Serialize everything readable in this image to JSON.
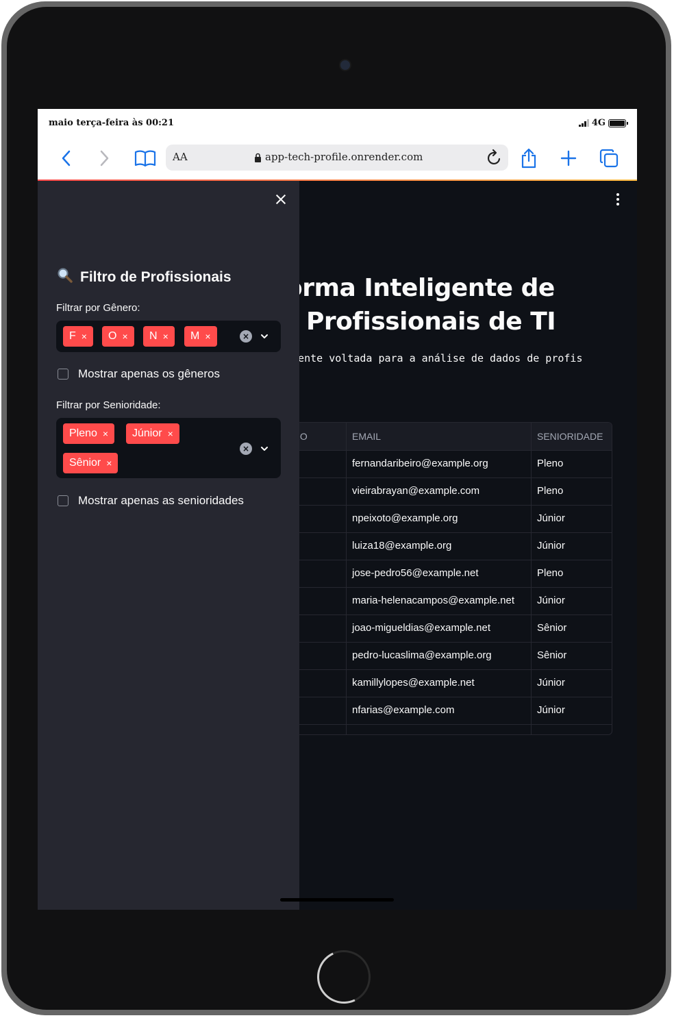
{
  "status_bar": {
    "datetime": "maio terça-feira às 00:21",
    "network": "4G"
  },
  "browser": {
    "reader_label": "AA",
    "url": "app-tech-profile.onrender.com"
  },
  "main": {
    "title_line1": "orma Inteligente de",
    "title_line2": "e Profissionais de TI",
    "subtitle": "igente voltada para a análise de dados de profis",
    "table": {
      "columns": [
        "ENERO",
        "EMAIL",
        "SENIORIDADE"
      ],
      "rows": [
        {
          "email": "fernandaribeiro@example.org",
          "senioridade": "Pleno"
        },
        {
          "email": "vieirabrayan@example.com",
          "senioridade": "Pleno"
        },
        {
          "email": "npeixoto@example.org",
          "senioridade": "Júnior"
        },
        {
          "email": "luiza18@example.org",
          "senioridade": "Júnior"
        },
        {
          "email": "jose-pedro56@example.net",
          "senioridade": "Pleno"
        },
        {
          "email": "maria-helenacampos@example.net",
          "senioridade": "Júnior"
        },
        {
          "email": "joao-migueldias@example.net",
          "senioridade": "Sênior"
        },
        {
          "email": "pedro-lucaslima@example.org",
          "senioridade": "Sênior"
        },
        {
          "email": "kamillylopes@example.net",
          "senioridade": "Júnior"
        },
        {
          "email": "nfarias@example.com",
          "senioridade": "Júnior"
        }
      ]
    }
  },
  "sidebar": {
    "title": "Filtro de Profissionais",
    "genero_label": "Filtrar por Gênero:",
    "genero_tags": [
      "F",
      "O",
      "N",
      "M"
    ],
    "genero_checkbox": "Mostrar apenas os gêneros",
    "senioridade_label": "Filtrar por Senioridade:",
    "senioridade_tags": [
      "Pleno",
      "Júnior",
      "Sênior"
    ],
    "senioridade_checkbox": "Mostrar apenas as senioridades",
    "tag_remove": "×"
  },
  "colors": {
    "accent": "#ff4b4b",
    "background": "#0e1117",
    "sidebar": "#262730",
    "ios_blue": "#1a73e8"
  }
}
